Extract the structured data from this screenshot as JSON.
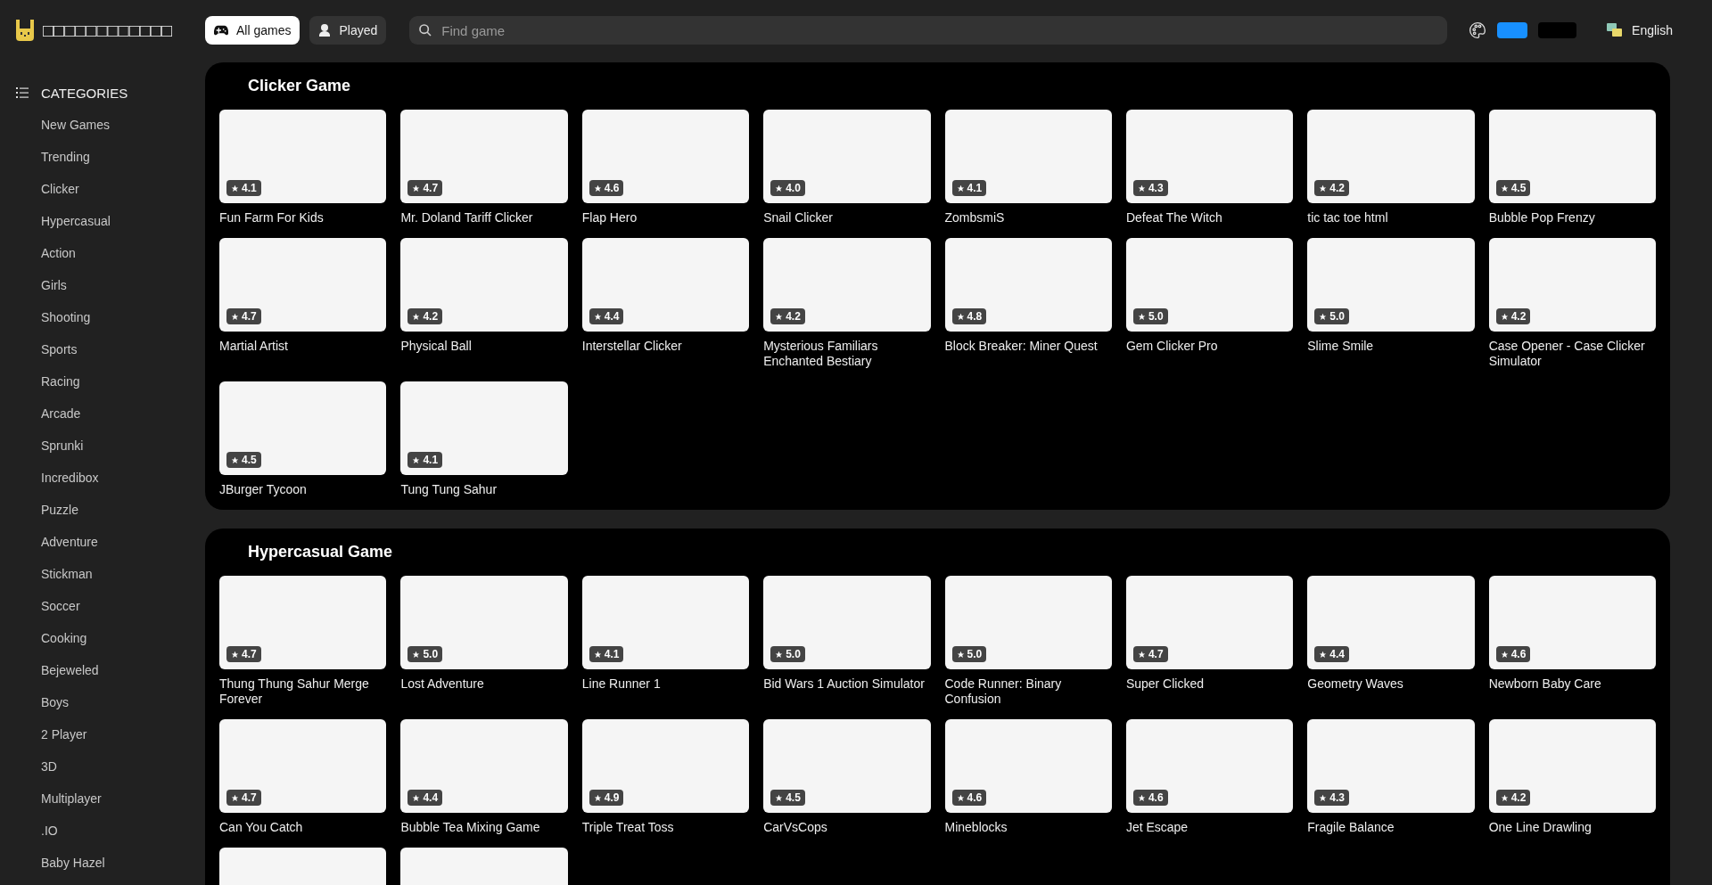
{
  "logo": {
    "text": "□□□□□□□□□□□□"
  },
  "nav_tabs": [
    {
      "label": "All games",
      "kind": "gamepad",
      "selected": true
    },
    {
      "label": "Played",
      "kind": "user",
      "selected": false
    }
  ],
  "search": {
    "placeholder": "Find game"
  },
  "theme_swatches": [
    {
      "color": "#1890ff"
    },
    {
      "color": "#000000"
    }
  ],
  "language": {
    "label": "English"
  },
  "sidebar": {
    "heading": "CATEGORIES",
    "items": [
      "New Games",
      "Trending",
      "Clicker",
      "Hypercasual",
      "Action",
      "Girls",
      "Shooting",
      "Sports",
      "Racing",
      "Arcade",
      "Sprunki",
      "Incredibox",
      "Puzzle",
      "Adventure",
      "Stickman",
      "Soccer",
      "Cooking",
      "Bejeweled",
      "Boys",
      "2 Player",
      "3D",
      "Multiplayer",
      ".IO",
      "Baby Hazel"
    ]
  },
  "sections": [
    {
      "title": "Clicker Game",
      "games": [
        {
          "kind": "game",
          "title": "Fun Farm For Kids",
          "rating": "4.1"
        },
        {
          "kind": "game",
          "title": "Mr. Doland Tariff Clicker",
          "rating": "4.7"
        },
        {
          "kind": "game",
          "title": "Flap Hero",
          "rating": "4.6"
        },
        {
          "kind": "game",
          "title": "Snail Clicker",
          "rating": "4.0"
        },
        {
          "kind": "game",
          "title": "ZombsmiS",
          "rating": "4.1"
        },
        {
          "kind": "game",
          "title": "Defeat The Witch",
          "rating": "4.3"
        },
        {
          "kind": "game",
          "title": "tic tac toe html",
          "rating": "4.2"
        },
        {
          "kind": "game",
          "title": "Bubble Pop Frenzy",
          "rating": "4.5"
        },
        {
          "kind": "game",
          "title": "Martial Artist",
          "rating": "4.7"
        },
        {
          "kind": "game",
          "title": "Physical Ball",
          "rating": "4.2"
        },
        {
          "kind": "game",
          "title": "Interstellar Clicker",
          "rating": "4.4"
        },
        {
          "kind": "game",
          "title": "Mysterious Familiars Enchanted Bestiary",
          "rating": "4.2"
        },
        {
          "kind": "game",
          "title": "Block Breaker: Miner Quest",
          "rating": "4.8"
        },
        {
          "kind": "game",
          "title": "Gem Clicker Pro",
          "rating": "5.0"
        },
        {
          "kind": "game",
          "title": "Slime Smile",
          "rating": "5.0"
        },
        {
          "kind": "game",
          "title": "Case Opener - Case Clicker Simulator",
          "rating": "4.2"
        },
        {
          "kind": "game",
          "title": "JBurger Tycoon",
          "rating": "4.5"
        },
        {
          "kind": "game",
          "title": "Tung Tung Sahur",
          "rating": "4.1"
        }
      ]
    },
    {
      "title": "Hypercasual Game",
      "games": [
        {
          "kind": "game",
          "title": "Thung Thung Sahur Merge Forever",
          "rating": "4.7"
        },
        {
          "kind": "game",
          "title": "Lost Adventure",
          "rating": "5.0"
        },
        {
          "kind": "game",
          "title": "Line Runner 1",
          "rating": "4.1"
        },
        {
          "kind": "game",
          "title": "Bid Wars 1 Auction Simulator",
          "rating": "5.0"
        },
        {
          "kind": "game",
          "title": "Code Runner: Binary Confusion",
          "rating": "5.0"
        },
        {
          "kind": "game",
          "title": "Super Clicked",
          "rating": "4.7"
        },
        {
          "kind": "game",
          "title": "Geometry Waves",
          "rating": "4.4"
        },
        {
          "kind": "game",
          "title": "Newborn Baby Care",
          "rating": "4.6"
        },
        {
          "kind": "game",
          "title": "Can You Catch",
          "rating": "4.7"
        },
        {
          "kind": "game",
          "title": "Bubble Tea Mixing Game",
          "rating": "4.4"
        },
        {
          "kind": "game",
          "title": "Triple Treat Toss",
          "rating": "4.9"
        },
        {
          "kind": "game",
          "title": "CarVsCops",
          "rating": "4.5"
        },
        {
          "kind": "game",
          "title": "Mineblocks",
          "rating": "4.6"
        },
        {
          "kind": "game",
          "title": "Jet Escape",
          "rating": "4.6"
        },
        {
          "kind": "game",
          "title": "Fragile Balance",
          "rating": "4.3"
        },
        {
          "kind": "game",
          "title": "One Line Drawling",
          "rating": "4.2"
        },
        {
          "kind": "cut"
        },
        {
          "kind": "cut"
        }
      ]
    }
  ]
}
